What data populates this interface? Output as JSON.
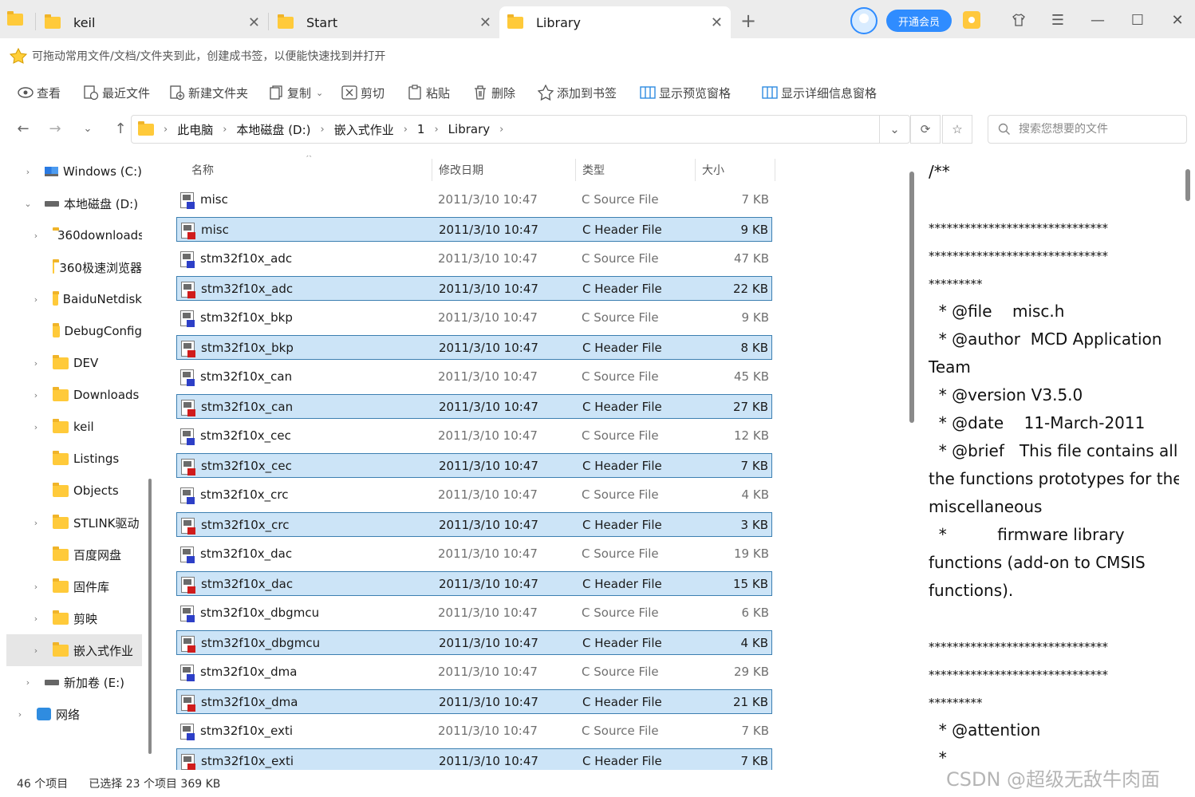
{
  "tabs": [
    {
      "label": "keil"
    },
    {
      "label": "Start"
    },
    {
      "label": "Library"
    }
  ],
  "vip_button": "开通会员",
  "bookmark_hint": "可拖动常用文件/文档/文件夹到此，创建成书签，以便能快速找到并打开",
  "toolbar": {
    "view": "查看",
    "recent": "最近文件",
    "new_folder": "新建文件夹",
    "copy": "复制",
    "cut": "剪切",
    "paste": "粘贴",
    "delete": "删除",
    "add_bookmark": "添加到书签",
    "preview_pane": "显示预览窗格",
    "details_pane": "显示详细信息窗格"
  },
  "breadcrumb": [
    "此电脑",
    "本地磁盘 (D:)",
    "嵌入式作业",
    "1",
    "Library"
  ],
  "search": {
    "placeholder": "搜索您想要的文件"
  },
  "sidebar": [
    {
      "label": "Windows (C:)",
      "icon": "windows-drive"
    },
    {
      "label": "本地磁盘 (D:)",
      "icon": "drive"
    },
    {
      "label": "360downloads",
      "icon": "folder"
    },
    {
      "label": "360极速浏览器",
      "icon": "folder"
    },
    {
      "label": "BaiduNetdisk",
      "icon": "folder"
    },
    {
      "label": "DebugConfig",
      "icon": "folder"
    },
    {
      "label": "DEV",
      "icon": "folder"
    },
    {
      "label": "Downloads",
      "icon": "folder"
    },
    {
      "label": "keil",
      "icon": "folder"
    },
    {
      "label": "Listings",
      "icon": "folder"
    },
    {
      "label": "Objects",
      "icon": "folder"
    },
    {
      "label": "STLINK驱动",
      "icon": "folder"
    },
    {
      "label": "百度网盘",
      "icon": "folder"
    },
    {
      "label": "固件库",
      "icon": "folder"
    },
    {
      "label": "剪映",
      "icon": "folder"
    },
    {
      "label": "嵌入式作业",
      "icon": "folder"
    },
    {
      "label": "新加卷 (E:)",
      "icon": "drive"
    },
    {
      "label": "网络",
      "icon": "network"
    }
  ],
  "columns": {
    "name": "名称",
    "date": "修改日期",
    "type": "类型",
    "size": "大小"
  },
  "files": [
    {
      "name": "misc",
      "date": "2011/3/10 10:47",
      "type": "C Source File",
      "size": "7 KB"
    },
    {
      "name": "misc",
      "date": "2011/3/10 10:47",
      "type": "C Header File",
      "size": "9 KB"
    },
    {
      "name": "stm32f10x_adc",
      "date": "2011/3/10 10:47",
      "type": "C Source File",
      "size": "47 KB"
    },
    {
      "name": "stm32f10x_adc",
      "date": "2011/3/10 10:47",
      "type": "C Header File",
      "size": "22 KB"
    },
    {
      "name": "stm32f10x_bkp",
      "date": "2011/3/10 10:47",
      "type": "C Source File",
      "size": "9 KB"
    },
    {
      "name": "stm32f10x_bkp",
      "date": "2011/3/10 10:47",
      "type": "C Header File",
      "size": "8 KB"
    },
    {
      "name": "stm32f10x_can",
      "date": "2011/3/10 10:47",
      "type": "C Source File",
      "size": "45 KB"
    },
    {
      "name": "stm32f10x_can",
      "date": "2011/3/10 10:47",
      "type": "C Header File",
      "size": "27 KB"
    },
    {
      "name": "stm32f10x_cec",
      "date": "2011/3/10 10:47",
      "type": "C Source File",
      "size": "12 KB"
    },
    {
      "name": "stm32f10x_cec",
      "date": "2011/3/10 10:47",
      "type": "C Header File",
      "size": "7 KB"
    },
    {
      "name": "stm32f10x_crc",
      "date": "2011/3/10 10:47",
      "type": "C Source File",
      "size": "4 KB"
    },
    {
      "name": "stm32f10x_crc",
      "date": "2011/3/10 10:47",
      "type": "C Header File",
      "size": "3 KB"
    },
    {
      "name": "stm32f10x_dac",
      "date": "2011/3/10 10:47",
      "type": "C Source File",
      "size": "19 KB"
    },
    {
      "name": "stm32f10x_dac",
      "date": "2011/3/10 10:47",
      "type": "C Header File",
      "size": "15 KB"
    },
    {
      "name": "stm32f10x_dbgmcu",
      "date": "2011/3/10 10:47",
      "type": "C Source File",
      "size": "6 KB"
    },
    {
      "name": "stm32f10x_dbgmcu",
      "date": "2011/3/10 10:47",
      "type": "C Header File",
      "size": "4 KB"
    },
    {
      "name": "stm32f10x_dma",
      "date": "2011/3/10 10:47",
      "type": "C Source File",
      "size": "29 KB"
    },
    {
      "name": "stm32f10x_dma",
      "date": "2011/3/10 10:47",
      "type": "C Header File",
      "size": "21 KB"
    },
    {
      "name": "stm32f10x_exti",
      "date": "2011/3/10 10:47",
      "type": "C Source File",
      "size": "7 KB"
    },
    {
      "name": "stm32f10x_exti",
      "date": "2011/3/10 10:47",
      "type": "C Header File",
      "size": "7 KB"
    }
  ],
  "preview_lines": [
    "/**",
    "",
    "******************************",
    "******************************",
    "*********",
    "  * @file    misc.h",
    "  * @author  MCD Application",
    "Team",
    "  * @version V3.5.0",
    "  * @date    11-March-2011",
    "  * @brief   This file contains all",
    "the functions prototypes for the",
    "miscellaneous",
    "  *          firmware library",
    "functions (add-on to CMSIS",
    "functions).",
    "",
    "******************************",
    "******************************",
    "*********",
    "  * @attention",
    "  *"
  ],
  "status": {
    "count": "46 个项目",
    "selected": "已选择 23 个项目  369 KB"
  },
  "watermark": "CSDN @超级无敌牛肉面"
}
